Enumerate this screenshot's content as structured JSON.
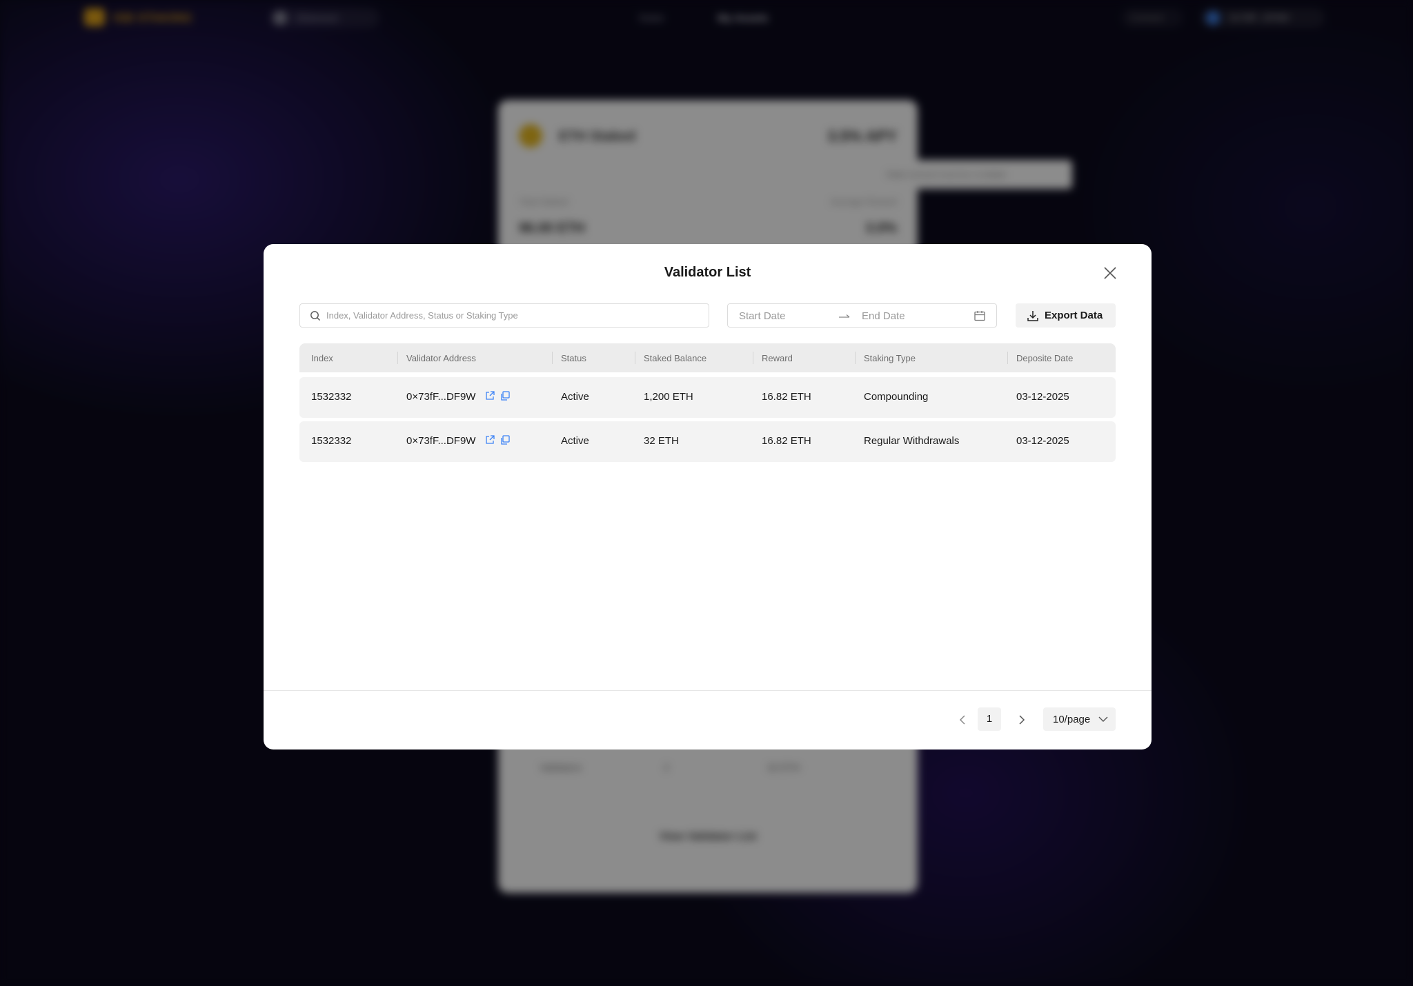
{
  "background": {
    "nav": {
      "logo_text": "ISB STAKING",
      "network": "Ethereum",
      "links": [
        "Stake",
        "My Assets"
      ],
      "button1": "Connect",
      "button2": "0x73fF...DF9W"
    },
    "card": {
      "title": "ETH Staked",
      "apy": "3.5% APY",
      "label_left": "Total Staked",
      "label_right": "Average Reward",
      "value_left": "96.00 ETH",
      "value_right": "3.0%",
      "foot": [
        "Validators",
        "2",
        "32 ETH"
      ],
      "bottom_link": "View Validator List"
    },
    "tooltip": "Stake amount must be a multiple"
  },
  "modal": {
    "title": "Validator List",
    "search": {
      "placeholder": "Index, Validator Address, Status or Staking Type"
    },
    "date_range": {
      "start_placeholder": "Start Date",
      "end_placeholder": "End Date"
    },
    "export_label": "Export Data",
    "columns": [
      "Index",
      "Validator Address",
      "Status",
      "Staked Balance",
      "Reward",
      "Staking Type",
      "Deposite Date"
    ],
    "rows": [
      {
        "index": "1532332",
        "address": "0×73fF...DF9W",
        "status": "Active",
        "staked_balance": "1,200 ETH",
        "reward": "16.82 ETH",
        "staking_type": "Compounding",
        "deposit_date": "03-12-2025"
      },
      {
        "index": "1532332",
        "address": "0×73fF...DF9W",
        "status": "Active",
        "staked_balance": "32 ETH",
        "reward": "16.82 ETH",
        "staking_type": "Regular Withdrawals",
        "deposit_date": "03-12-2025"
      }
    ],
    "pagination": {
      "current_page": "1",
      "page_size": "10/page"
    }
  },
  "colors": {
    "link_icon": "#3b82f6",
    "background": "#0b0a1c"
  },
  "icons": [
    "search-icon",
    "arrow-right-icon",
    "calendar-icon",
    "download-icon",
    "close-icon",
    "external-link-icon",
    "copy-icon",
    "chevron-left-icon",
    "chevron-right-icon",
    "chevron-down-icon"
  ]
}
